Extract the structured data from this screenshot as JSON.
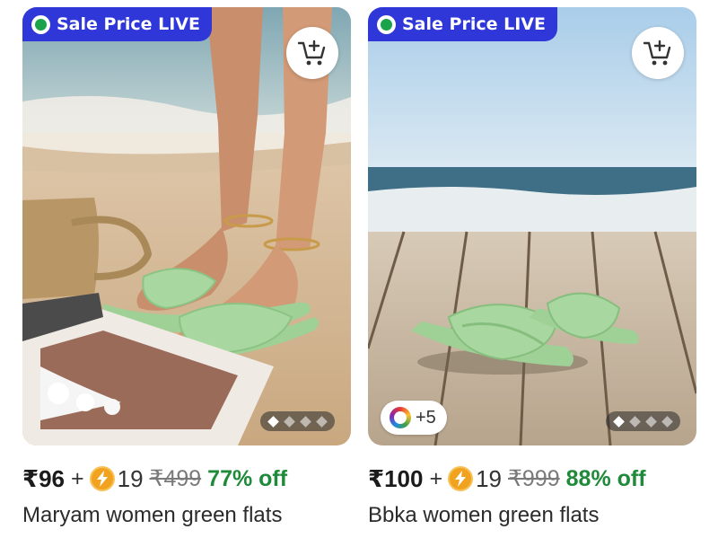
{
  "products": [
    {
      "badge": "Sale Price LIVE",
      "cart_icon": "add-to-cart-icon",
      "price": "₹96",
      "plus": "+",
      "coins": "19",
      "mrp": "₹499",
      "discount": "77% off",
      "name": "Maryam women green flats",
      "image_slides": 4,
      "active_slide": 1
    },
    {
      "badge": "Sale Price LIVE",
      "cart_icon": "add-to-cart-icon",
      "price": "₹100",
      "plus": "+",
      "coins": "19",
      "mrp": "₹999",
      "discount": "88% off",
      "name": "Bbka women green flats",
      "variants": "+5",
      "image_slides": 4,
      "active_slide": 1
    }
  ],
  "colors": {
    "badge_bg": "#2f37d9",
    "live_dot": "#1aa34a",
    "discount": "#1f8a3a",
    "coin": "#f1a320",
    "sandal": "#a8d8a0"
  }
}
